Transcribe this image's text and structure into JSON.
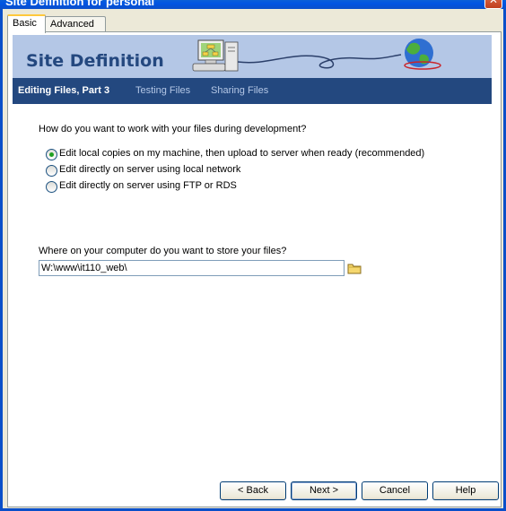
{
  "window": {
    "title": "Site Definition for personal",
    "close_label": "✕"
  },
  "tabs": [
    {
      "label": "Basic",
      "active": true
    },
    {
      "label": "Advanced",
      "active": false
    }
  ],
  "banner": {
    "title": "Site Definition"
  },
  "steps": {
    "current": "Editing Files, Part 3",
    "next1": "Testing Files",
    "next2": "Sharing Files"
  },
  "question": "How do you want to work with your files during development?",
  "options": [
    {
      "label": "Edit local copies on my machine, then upload to server when ready (recommended)",
      "checked": true
    },
    {
      "label": "Edit directly on server using local network",
      "checked": false
    },
    {
      "label": "Edit directly on server using FTP or RDS",
      "checked": false
    }
  ],
  "folder_question": "Where on your computer do you want to store your files?",
  "folder_path": "W:\\www\\it110_web\\",
  "buttons": {
    "back": "< Back",
    "next": "Next >",
    "cancel": "Cancel",
    "help": "Help"
  },
  "colors": {
    "banner_bg": "#b4c7e6",
    "steps_bg": "#23487f",
    "title_blue": "#24487f"
  }
}
